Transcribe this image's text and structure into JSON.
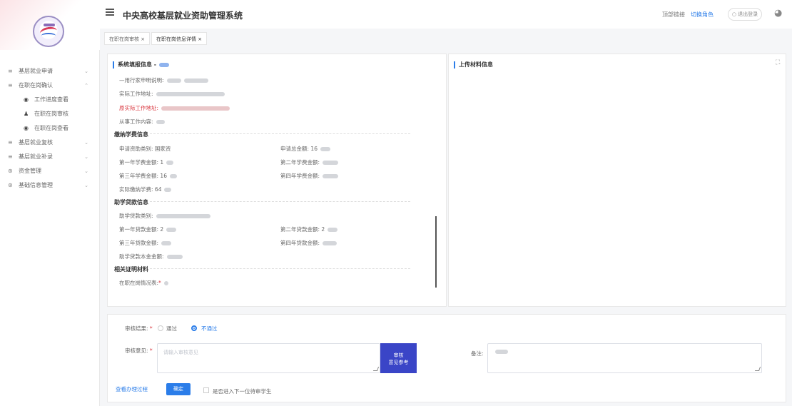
{
  "app": {
    "title": "中央高校基层就业资助管理系统",
    "header_links": [
      "顶部链接",
      "切换角色"
    ],
    "logout": "退出登录",
    "colors": {
      "accent": "#2b7de9",
      "reference_button": "#3a45c7",
      "error": "#d9363e"
    }
  },
  "tabs": [
    {
      "label": "在职在岗审核 ×"
    },
    {
      "label": "在职在岗信息详情 ×"
    }
  ],
  "sidebar": {
    "items": [
      {
        "label": "基层就业申请",
        "icon": "list-icon",
        "arrow": "⌄"
      },
      {
        "label": "在职在岗确认",
        "icon": "list-icon",
        "arrow": "⌃"
      },
      {
        "label": "工作进度查看",
        "icon": "eye-icon",
        "arrow": ""
      },
      {
        "label": "在职在岗审核",
        "icon": "user-icon",
        "arrow": ""
      },
      {
        "label": "在职在岗查看",
        "icon": "eye-icon",
        "arrow": ""
      },
      {
        "label": "基层就业复核",
        "icon": "list-icon",
        "arrow": "⌄"
      },
      {
        "label": "基层就业补录",
        "icon": "list-icon",
        "arrow": "⌄"
      },
      {
        "label": "资金管理",
        "icon": "fund-icon",
        "arrow": "⌄"
      },
      {
        "label": "基础信息管理",
        "icon": "fund-icon",
        "arrow": "⌄"
      }
    ]
  },
  "left_panel": {
    "title": "系统填报信息 -",
    "fields_top": [
      {
        "label": "—用行家申明说明:",
        "red": false
      },
      {
        "label": "实际工作地址:",
        "red": false
      },
      {
        "label": "原实际工作地址:",
        "red": true
      },
      {
        "label": "从事工作内容:",
        "red": false
      }
    ],
    "tuition_section": "缴纳学费信息",
    "tuition_fields": [
      "申请资助类别:",
      "申请总金额:",
      "第一年学费金额:",
      "第二年学费金额:",
      "第三年学费金额:",
      "第四年学费金额:",
      "实际缴纳学费:"
    ],
    "tuition_values": [
      "国家资",
      "16",
      "1",
      "",
      "16",
      "",
      "64"
    ],
    "loan_section": "助学贷款信息",
    "loan_fields": [
      "助学贷款类别:",
      "第一年贷款金额:",
      "第二年贷款金额:",
      "第三年贷款金额:",
      "第四年贷款金额:",
      "助学贷款本金金额:"
    ],
    "loan_values": [
      "",
      "2",
      "2",
      "",
      "",
      ""
    ],
    "proof_section": "相关证明材料",
    "proof_field": "在职在岗情况表:",
    "required_mark": "*"
  },
  "right_panel": {
    "title": "上传材料信息"
  },
  "review": {
    "result_label": "审核结果:",
    "required_mark": "*",
    "options": [
      "通过",
      "不通过"
    ],
    "selected": "不通过",
    "opinion_label": "审核意见:",
    "opinion_placeholder": "请输入审核意见",
    "reference_button": [
      "审核",
      "意见参考"
    ],
    "remark_label": "备注:",
    "view_process_link": "查看办理过程",
    "confirm": "确定",
    "next_checkbox": "是否进入下一位待审学生"
  }
}
